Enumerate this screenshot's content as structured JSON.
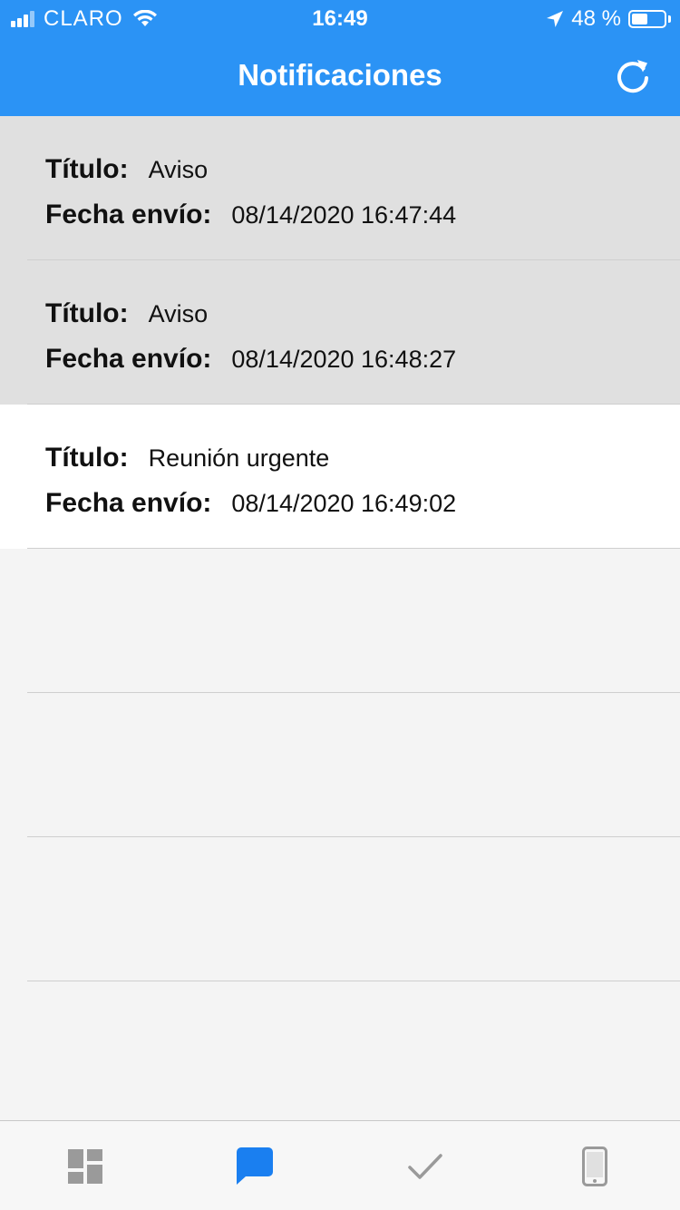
{
  "status_bar": {
    "carrier": "CLARO",
    "time": "16:49",
    "battery": "48 %",
    "battery_level": 0.48
  },
  "header": {
    "title": "Notificaciones",
    "refresh_icon": "refresh-icon"
  },
  "notifications": [
    {
      "title_label": "Título:",
      "title": "Aviso",
      "date_label": "Fecha envío:",
      "date": "08/14/2020 16:47:44",
      "read": true
    },
    {
      "title_label": "Título:",
      "title": "Aviso",
      "date_label": "Fecha envío:",
      "date": "08/14/2020 16:48:27",
      "read": true
    },
    {
      "title_label": "Título:",
      "title": "Reunión urgente",
      "date_label": "Fecha envío:",
      "date": "08/14/2020 16:49:02",
      "read": false
    }
  ],
  "tabbar": {
    "tabs": [
      {
        "icon": "dashboard-icon",
        "active": false
      },
      {
        "icon": "chat-icon",
        "active": true
      },
      {
        "icon": "checkmark-icon",
        "active": false
      },
      {
        "icon": "phone-icon",
        "active": false
      }
    ]
  },
  "colors": {
    "header": "#2b93f5",
    "active_tab": "#1a7ff0",
    "inactive_tab": "#9a9a9a",
    "read_row": "#e0e0e0",
    "unread_row": "#ffffff"
  }
}
